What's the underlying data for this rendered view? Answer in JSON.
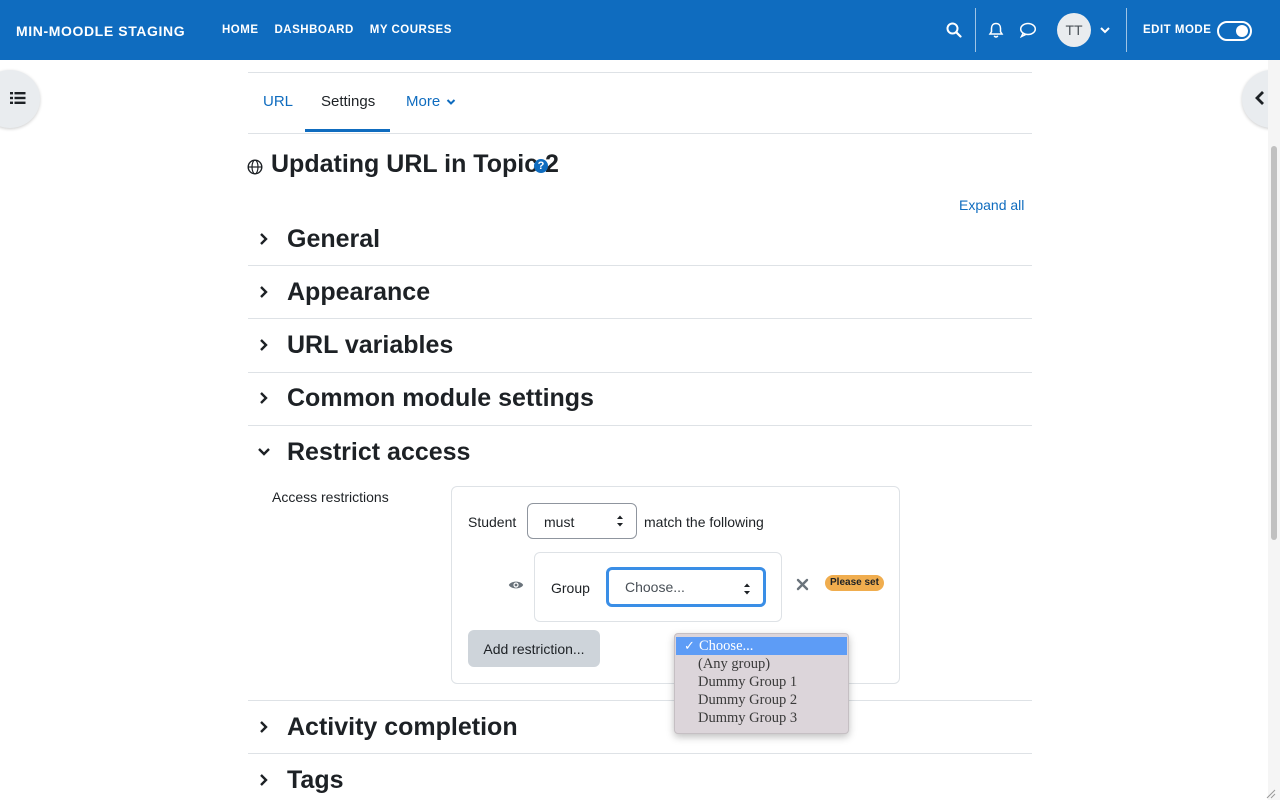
{
  "navbar": {
    "brand": "MIN-MOODLE STAGING",
    "links": [
      "HOME",
      "DASHBOARD",
      "MY COURSES"
    ],
    "avatar_initials": "TT",
    "edit_mode_label": "EDIT MODE",
    "edit_mode_on": true,
    "color": "#0f6cbf"
  },
  "secondary_nav": {
    "tabs": [
      {
        "label": "URL"
      },
      {
        "label": "Settings",
        "active": true
      },
      {
        "label": "More"
      }
    ]
  },
  "page": {
    "title": "Updating URL in Topic 2",
    "expand_all": "Expand all"
  },
  "sections": [
    {
      "title": "General",
      "expanded": false
    },
    {
      "title": "Appearance",
      "expanded": false
    },
    {
      "title": "URL variables",
      "expanded": false
    },
    {
      "title": "Common module settings",
      "expanded": false
    },
    {
      "title": "Restrict access",
      "expanded": true
    },
    {
      "title": "Activity completion",
      "expanded": false
    },
    {
      "title": "Tags",
      "expanded": false
    }
  ],
  "restrict_access": {
    "label": "Access restrictions",
    "student_label": "Student",
    "match_value": "must",
    "match_suffix": "match the following",
    "condition_label": "Group",
    "group_value": "Choose...",
    "badge": "Please set",
    "add_button": "Add restriction..."
  },
  "group_dropdown": {
    "options": [
      "Choose...",
      "(Any group)",
      "Dummy Group 1",
      "Dummy Group 2",
      "Dummy Group 3"
    ],
    "selected_index": 0,
    "check": "✓"
  }
}
